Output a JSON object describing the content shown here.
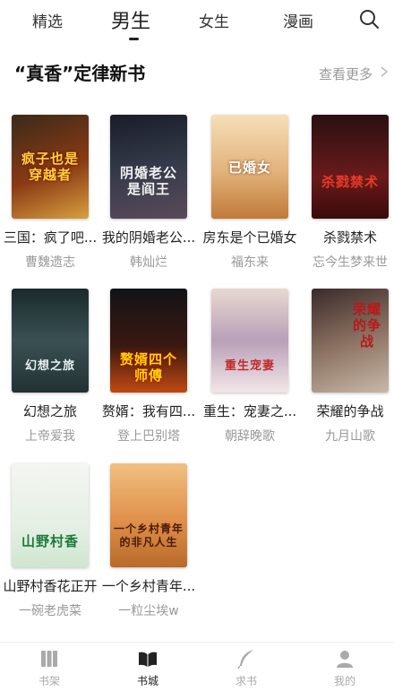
{
  "top_tabs": [
    {
      "label": "精选"
    },
    {
      "label": "男生"
    },
    {
      "label": "女生"
    },
    {
      "label": "漫画"
    }
  ],
  "section": {
    "title": "“真香”定律新书",
    "see_more": "查看更多"
  },
  "books": [
    {
      "title": "三国：疯了吧...",
      "author": "曹魏遗志",
      "cover_text": "疯子也是穿越者"
    },
    {
      "title": "我的阴婚老公...",
      "author": "韩灿烂",
      "cover_text": "阴婚老公是阎王"
    },
    {
      "title": "房东是个已婚女",
      "author": "福东来",
      "cover_text": "已婚女"
    },
    {
      "title": "杀戮禁术",
      "author": "忘今生梦来世",
      "cover_text": "杀戮禁术"
    },
    {
      "title": "幻想之旅",
      "author": "上帝爱我",
      "cover_text": "幻想之旅"
    },
    {
      "title": "赘婿：我有四...",
      "author": "登上巴别塔",
      "cover_text": "赘婿四个师傅"
    },
    {
      "title": "重生：宠妻之...",
      "author": "朝辞晚歌",
      "cover_text": "重生宠妻"
    },
    {
      "title": "荣耀的争战",
      "author": "九月山歌",
      "cover_text": "荣耀的争战"
    },
    {
      "title": "山野村香花正开",
      "author": "一碗老虎菜",
      "cover_text": "山野村香"
    },
    {
      "title": "一个乡村青年...",
      "author": "一粒尘埃w",
      "cover_text": "一个乡村青年的非凡人生"
    }
  ],
  "bottom_nav": [
    {
      "label": "书架",
      "icon": "bookshelf-icon"
    },
    {
      "label": "书城",
      "icon": "open-book-icon"
    },
    {
      "label": "求书",
      "icon": "feather-icon"
    },
    {
      "label": "我的",
      "icon": "person-icon"
    }
  ],
  "colors": {
    "active": "#222222",
    "muted": "#999999",
    "inactive_nav": "#aaaaaa"
  }
}
